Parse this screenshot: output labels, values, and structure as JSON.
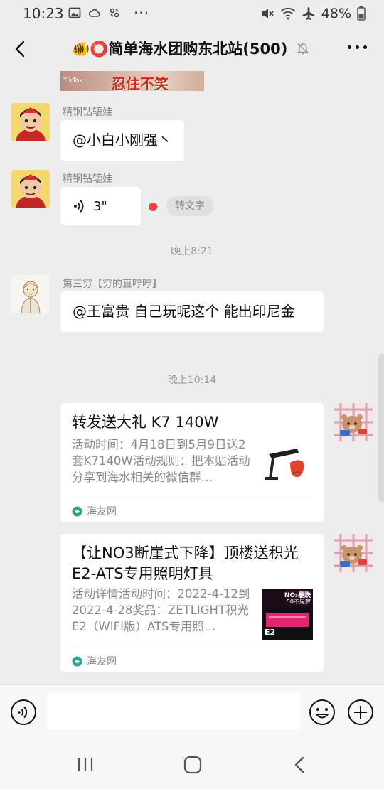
{
  "status_bar": {
    "time": "10:23",
    "dots": "···",
    "battery": "48%"
  },
  "header": {
    "title": "🐠⭕简单海水团购东北站(500)"
  },
  "messages": {
    "partial_image_text": "忍住不笑",
    "partial_image_small": "TikTok",
    "m1": {
      "sender": "精钢钻辘娃",
      "text": "@小白小刚强丶"
    },
    "m2": {
      "sender": "精钢钻辘娃",
      "duration": "3\"",
      "to_text": "转文字"
    },
    "time1": "晚上8:21",
    "m3": {
      "sender": "第三穷【穷的直哼哼】",
      "text": "@王富贵  自己玩呢这个  能出印尼金"
    },
    "time2": "晚上10:14",
    "card1": {
      "title": "转发送大礼 K7 140W",
      "desc": "活动时间：4月18日到5月9日送2套K7140W活动规则：把本贴活动分享到海水相关的微信群…",
      "source": "海友网"
    },
    "card2": {
      "title": "【让NO3断崖式下降】顶楼送积光E2-ATS专用照明灯具",
      "desc": "活动详情活动时间：2022-4-12到2022-4-28奖品：ZETLIGHT积光E2（WIFI版）ATS专用照…",
      "thumb_text_top": "NO₃暴跌",
      "thumb_text_mid": "50不是梦",
      "thumb_text_bottom": "E2",
      "source": "海友网"
    }
  },
  "input_bar": {
    "placeholder": ""
  },
  "colors": {
    "background": "#ededed",
    "bubble": "#ffffff",
    "accent_red": "#f04142"
  }
}
